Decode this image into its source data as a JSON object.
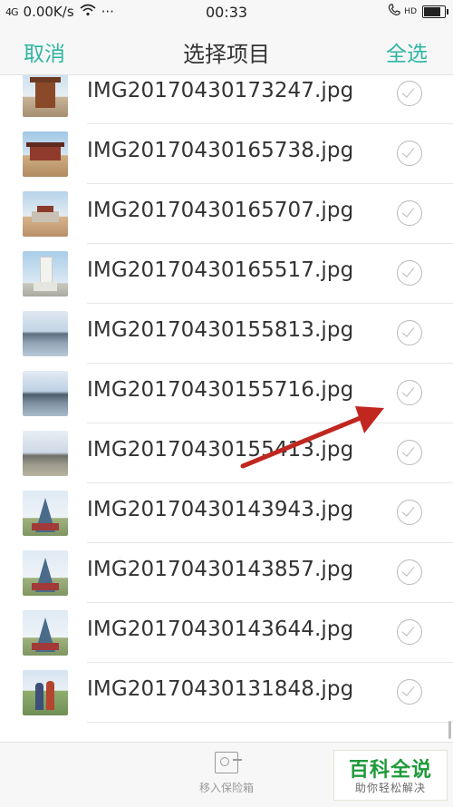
{
  "status_bar": {
    "signal": "4G",
    "speed": "0.00K/s",
    "wifi_icon": "wifi-icon",
    "more": "···",
    "time": "00:33",
    "call_icon": "phone-hd-icon",
    "hd": "HD",
    "battery_level": 0.85
  },
  "header": {
    "cancel_label": "取消",
    "title": "选择项目",
    "select_all_label": "全选",
    "accent_color": "#2fb5a3"
  },
  "files": [
    {
      "name": "IMG20170430173247.jpg",
      "thumb": "pagoda"
    },
    {
      "name": "IMG20170430165738.jpg",
      "thumb": "gate"
    },
    {
      "name": "IMG20170430165707.jpg",
      "thumb": "temple"
    },
    {
      "name": "IMG20170430165517.jpg",
      "thumb": "stupa"
    },
    {
      "name": "IMG20170430155813.jpg",
      "thumb": "lake"
    },
    {
      "name": "IMG20170430155716.jpg",
      "thumb": "lake2"
    },
    {
      "name": "IMG20170430155413.jpg",
      "thumb": "lake3"
    },
    {
      "name": "IMG20170430143943.jpg",
      "thumb": "obo"
    },
    {
      "name": "IMG20170430143857.jpg",
      "thumb": "obo"
    },
    {
      "name": "IMG20170430143644.jpg",
      "thumb": "obo"
    },
    {
      "name": "IMG20170430131848.jpg",
      "thumb": "people"
    }
  ],
  "bottom_bar": {
    "vault_icon": "safe-box-icon",
    "vault_label": "移入保险箱"
  },
  "watermark": {
    "title": "百科全说",
    "subtitle": "助你轻松解决"
  },
  "annotation": {
    "type": "red-arrow",
    "color": "#c0271f"
  }
}
